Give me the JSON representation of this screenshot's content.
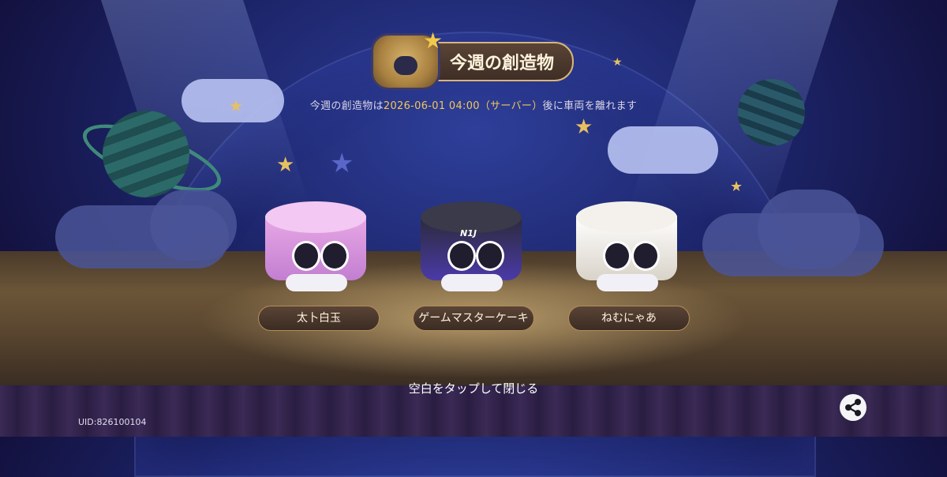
{
  "header": {
    "title": "今週の創造物"
  },
  "subtitle": {
    "prefix": "今週の創造物は",
    "datetime": "2026-06-01 04:00（サーバー）",
    "suffix": "後に車両を離れます"
  },
  "creatures": [
    {
      "name": "太卜白玉",
      "style": "pink"
    },
    {
      "name": "ゲームマスターケーキ",
      "style": "dark",
      "logo": "N1J"
    },
    {
      "name": "ねむにゃあ",
      "style": "white"
    }
  ],
  "close_hint": "空白をタップして閉じる",
  "uid": "UID:826100104",
  "icons": {
    "header_emblem": "creature-emblem-icon",
    "share": "share-icon"
  },
  "colors": {
    "accent_gold": "#f2c65a",
    "pill_brown": "#4a3830"
  }
}
